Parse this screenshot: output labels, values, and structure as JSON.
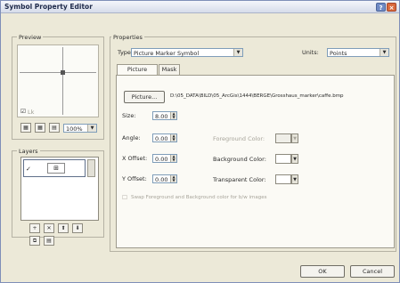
{
  "window": {
    "title": "Symbol Property Editor"
  },
  "preview": {
    "label": "Preview",
    "check_label": "Lk",
    "zoom_value": "100%",
    "zoom_icons": [
      "fit-icon",
      "actual-size-icon",
      "zoom-icon"
    ]
  },
  "layers": {
    "label": "Layers",
    "items": [
      {
        "checked": "✓",
        "thumb": "⊞"
      }
    ],
    "tool_icons": [
      "add-layer-icon",
      "remove-layer-icon",
      "move-up-icon",
      "move-down-icon",
      "copy-layer-icon",
      "paste-layer-icon"
    ],
    "tool_glyphs": [
      "+",
      "✕",
      "⬆",
      "⬇",
      "⧉",
      "▤"
    ]
  },
  "properties": {
    "label": "Properties",
    "type_label": "Type:",
    "type_value": "Picture Marker Symbol",
    "units_label": "Units:",
    "units_value": "Points"
  },
  "tabs": [
    {
      "label": "Picture Marker",
      "active": true
    },
    {
      "label": "Mask",
      "active": false
    }
  ],
  "picture": {
    "button_label": "Picture...",
    "path": "D:\\05_DATA\\BILD\\05_ArcGis\\1444\\BERGE\\Grosshaus_marker\\caffe.bmp"
  },
  "fields": {
    "size_label": "Size:",
    "size_value": "8.00",
    "angle_label": "Angle:",
    "angle_value": "0.00",
    "xoffset_label": "X Offset:",
    "xoffset_value": "0.00",
    "yoffset_label": "Y Offset:",
    "yoffset_value": "0.00"
  },
  "colors": {
    "foreground_label": "Foreground Color:",
    "background_label": "Background Color:",
    "transparent_label": "Transparent Color:"
  },
  "swap_checkbox_label": "Swap Foreground and Background color for b/w images",
  "footer": {
    "ok_label": "OK",
    "cancel_label": "Cancel"
  }
}
